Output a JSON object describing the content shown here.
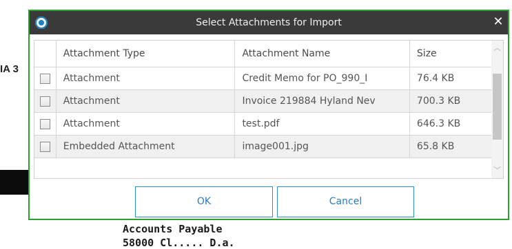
{
  "background": {
    "left_fragment": "IA 3",
    "doc_lines": [
      "Accounts Payable",
      "58000 Cl..... D.a."
    ]
  },
  "dialog": {
    "title": "Select Attachments for Import",
    "close_glyph": "✕",
    "columns": {
      "check": "",
      "type": "Attachment Type",
      "name": "Attachment Name",
      "size": "Size"
    },
    "rows": [
      {
        "checked": false,
        "type": "Attachment",
        "name": "Credit Memo for PO_990_I",
        "size": "76.4 KB"
      },
      {
        "checked": false,
        "type": "Attachment",
        "name": "Invoice 219884 Hyland Nev",
        "size": "700.3 KB"
      },
      {
        "checked": false,
        "type": "Attachment",
        "name": "test.pdf",
        "size": "646.3 KB"
      },
      {
        "checked": false,
        "type": "Embedded Attachment",
        "name": "image001.jpg",
        "size": "65.8 KB"
      }
    ],
    "ok_label": "OK",
    "cancel_label": "Cancel",
    "icons": {
      "app": "app-logo-icon",
      "close": "close-icon",
      "scroll_up": "chevron-up-icon",
      "scroll_down": "chevron-down-icon"
    },
    "colors": {
      "border": "#28a12f",
      "titlebar": "#3a3a3a",
      "button_accent": "#2a8ad0"
    }
  }
}
